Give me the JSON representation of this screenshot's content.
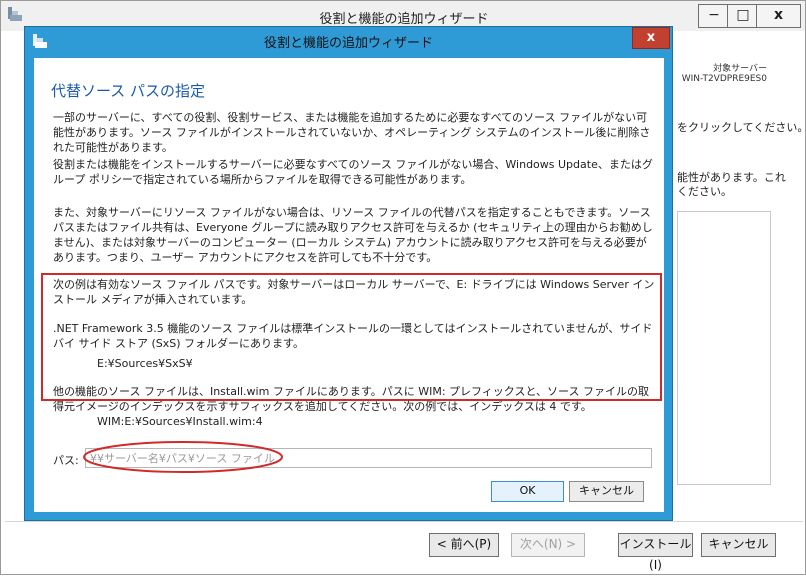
{
  "background_window": {
    "title": "役割と機能の追加ウィザード",
    "min_glyph": "−",
    "max_glyph": "□",
    "close_glyph": "x",
    "target_server_label": "対象サーバー",
    "target_server_name": "WIN-T2VDPRE9ES0",
    "text_click": "をクリックしてください。",
    "text_possible_1": "能性があります。これ",
    "text_possible_2": "ください。",
    "buttons": {
      "prev": "< 前へ(P)",
      "next": "次へ(N) >",
      "install": "インストール(I)",
      "cancel": "キャンセル"
    }
  },
  "dialog": {
    "title": "役割と機能の追加ウィザード",
    "close_glyph": "x",
    "heading": "代替ソース パスの指定",
    "paragraphs": {
      "p1": "一部のサーバーに、すべての役割、役割サービス、または機能を追加するために必要なすべてのソース ファイルがない可能性があります。ソース ファイルがインストールされていないか、オペレーティング システムのインストール後に削除された可能性があります。",
      "p2": "役割または機能をインストールするサーバーに必要なすべてのソース ファイルがない場合、Windows Update、またはグループ ポリシーで指定されている場所からファイルを取得できる可能性があります。",
      "p3": "また、対象サーバーにリソース ファイルがない場合は、リソース ファイルの代替パスを指定することもできます。ソース パスまたはファイル共有は、Everyone グループに読み取りアクセス許可を与えるか (セキュリティ上の理由からお勧めしません)、または対象サーバーのコンピューター (ローカル システム) アカウントに読み取りアクセス許可を与える必要があります。つまり、ユーザー アカウントにアクセスを許可しても不十分です。",
      "p4": "次の例は有効なソース ファイル パスです。対象サーバーはローカル サーバーで、E: ドライブには Windows Server インストール メディアが挿入されています。",
      "p5": ".NET Framework 3.5 機能のソース ファイルは標準インストールの一環としてはインストールされていませんが、サイド バイ サイド ストア (SxS) フォルダーにあります。",
      "p5_path": "E:¥Sources¥SxS¥",
      "p6": "他の機能のソース ファイルは、Install.wim ファイルにあります。パスに WIM: プレフィックスと、ソース ファイルの取得元イメージのインデックスを示すサフィックスを追加してください。次の例では、インデックスは 4 です。",
      "p6_path": "WIM:E:¥Sources¥Install.wim:4"
    },
    "path_label": "パス:",
    "path_value": "",
    "path_placeholder": "¥¥サーバー名¥パス¥ソース ファイル",
    "ok_label": "OK",
    "cancel_label": "キャンセル",
    "annotation_color": "#d12a2a",
    "accent_color": "#2f9bd6"
  }
}
